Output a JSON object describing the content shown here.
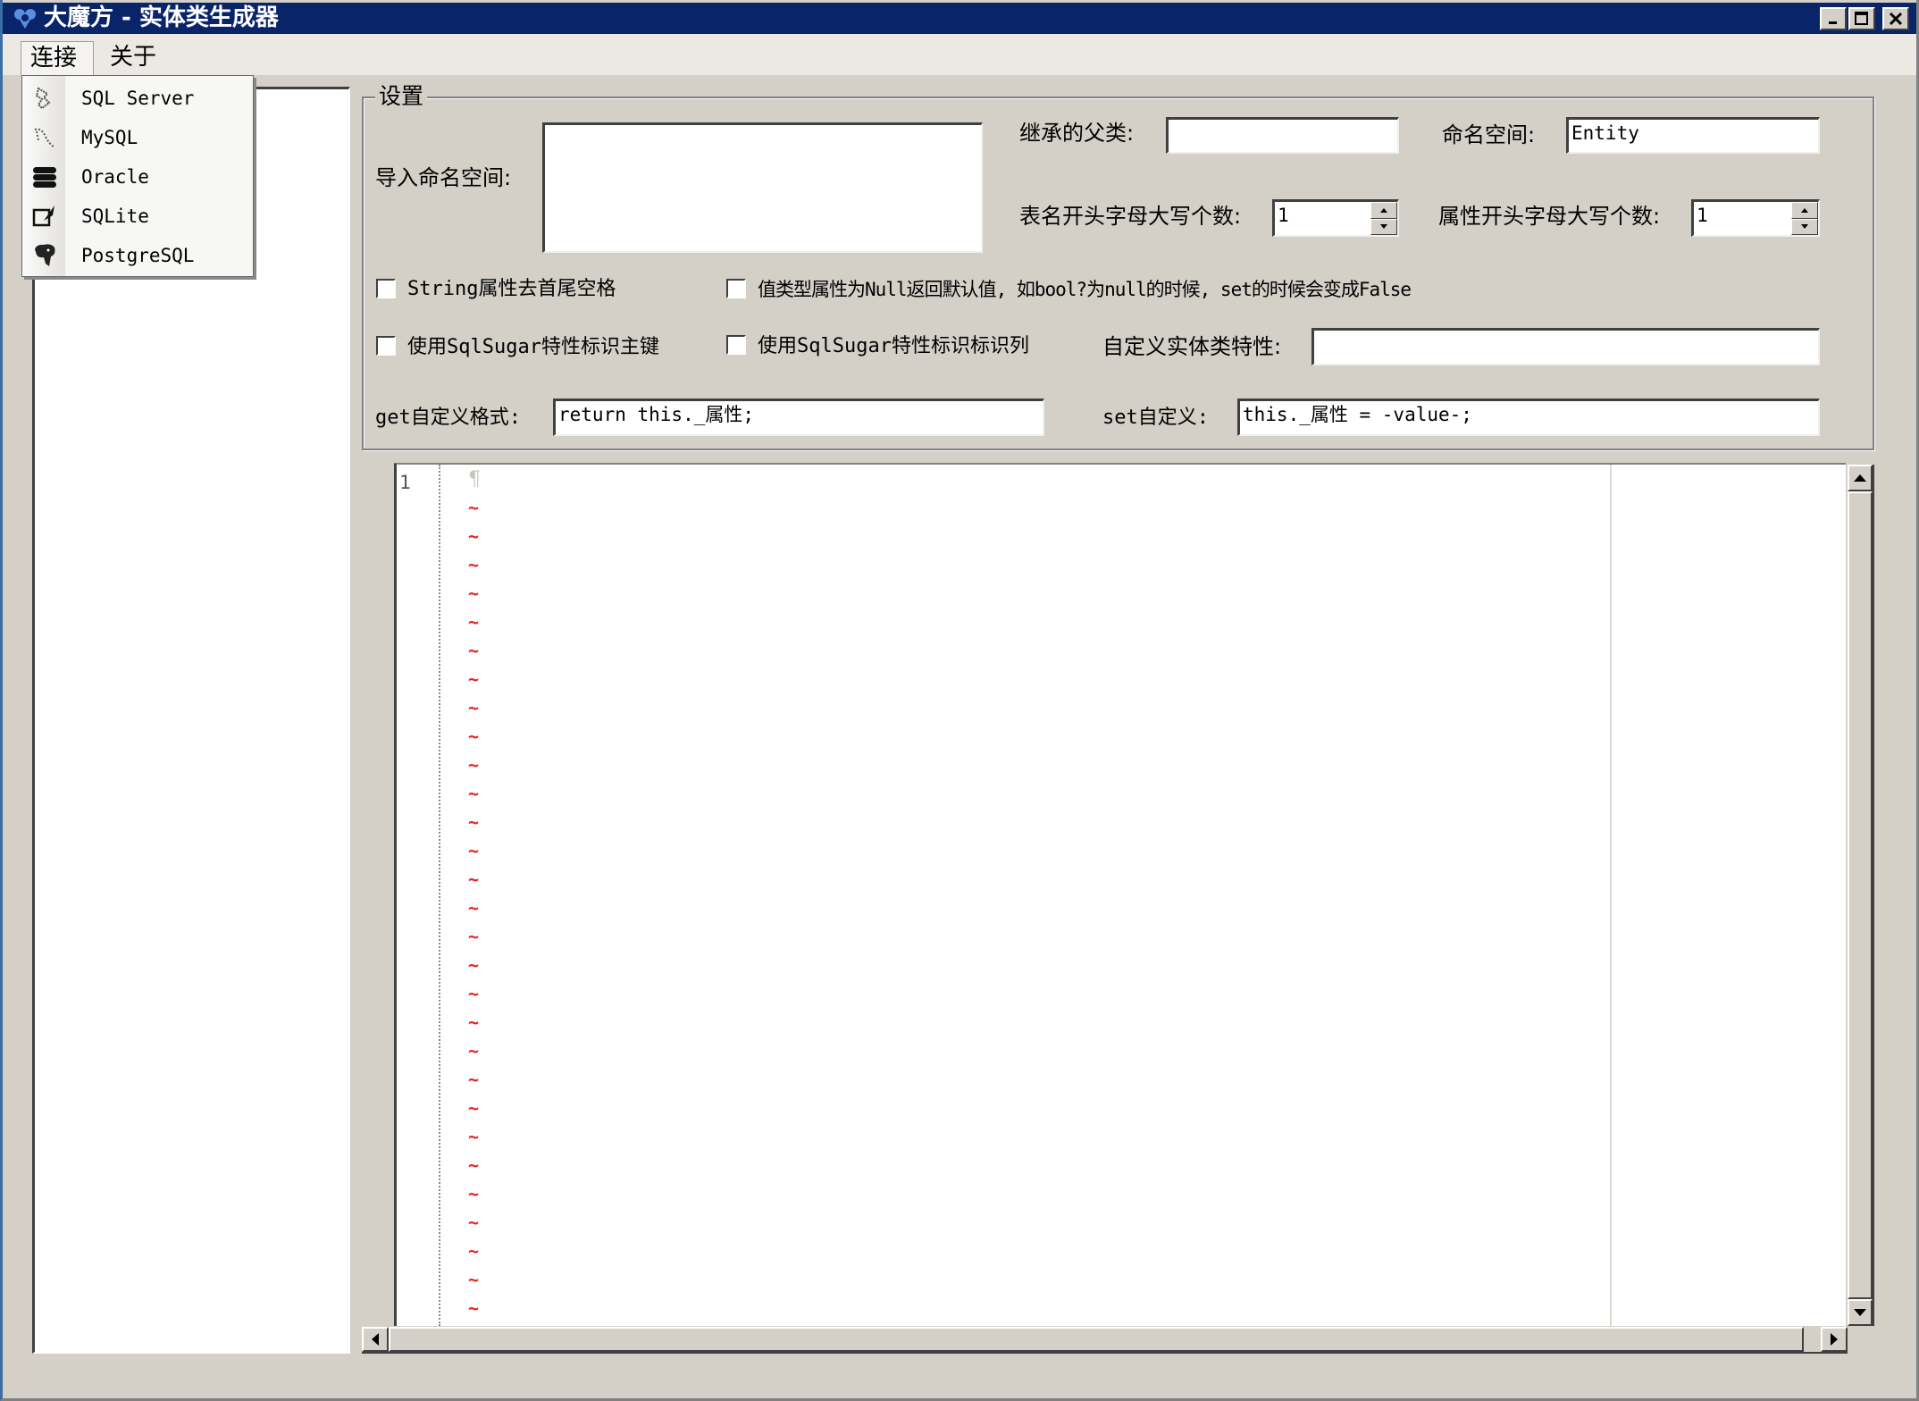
{
  "window": {
    "title": "大魔方 - 实体类生成器",
    "controls": [
      "minimize",
      "maximize",
      "close"
    ]
  },
  "menubar": {
    "items": [
      {
        "label": "连接",
        "active": true
      },
      {
        "label": "关于",
        "active": false
      }
    ]
  },
  "connect_menu": {
    "items": [
      {
        "label": "SQL Server",
        "icon": "sqlserver-icon"
      },
      {
        "label": "MySQL",
        "icon": "mysql-dolphin-icon"
      },
      {
        "label": "Oracle",
        "icon": "database-stack-icon"
      },
      {
        "label": "SQLite",
        "icon": "sqlite-feather-icon"
      },
      {
        "label": "PostgreSQL",
        "icon": "postgresql-elephant-icon"
      }
    ]
  },
  "settings": {
    "legend": "设置",
    "import_namespace": {
      "label": "导入命名空间:",
      "value": ""
    },
    "base_class": {
      "label": "继承的父类:",
      "value": ""
    },
    "namespace": {
      "label": "命名空间:",
      "value": "Entity"
    },
    "table_upper_count": {
      "label": "表名开头字母大写个数:",
      "value": "1"
    },
    "prop_upper_count": {
      "label": "属性开头字母大写个数:",
      "value": "1"
    },
    "checkboxes": [
      {
        "label": "String属性去首尾空格",
        "checked": false
      },
      {
        "label": "值类型属性为Null返回默认值, 如bool?为null的时候, set的时候会变成False",
        "checked": false
      },
      {
        "label": "使用SqlSugar特性标识主键",
        "checked": false
      },
      {
        "label": "使用SqlSugar特性标识标识列",
        "checked": false
      }
    ],
    "custom_attribute": {
      "label": "自定义实体类特性:",
      "value": ""
    },
    "get_format": {
      "label": "get自定义格式:",
      "value": "return this._属性;"
    },
    "set_format": {
      "label": "set自定义:",
      "value": "this._属性 = -value-;"
    }
  },
  "editor": {
    "line_number": "1",
    "pilcrow": "¶",
    "tilde": "~",
    "tilde_count": 29
  },
  "colors": {
    "titlebar": "#0a246a",
    "face": "#d4d0c8",
    "tilde": "#ee2222"
  }
}
